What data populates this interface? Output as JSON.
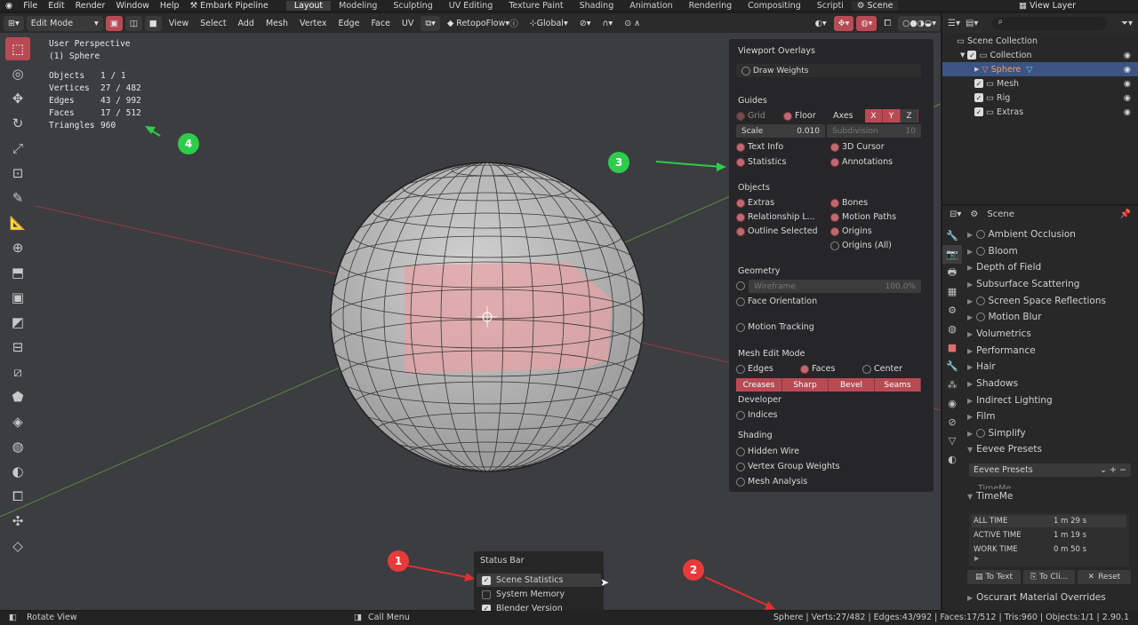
{
  "menu": [
    "File",
    "Edit",
    "Render",
    "Window",
    "Help"
  ],
  "pipeline_label": "Embark Pipeline",
  "workspaces": [
    "Layout",
    "Modeling",
    "Sculpting",
    "UV Editing",
    "Texture Paint",
    "Shading",
    "Animation",
    "Rendering",
    "Compositing",
    "Scripti"
  ],
  "scene_name": "Scene",
  "view_layer": "View Layer",
  "header": {
    "mode": "Edit Mode",
    "menus": [
      "View",
      "Select",
      "Add",
      "Mesh",
      "Vertex",
      "Edge",
      "Face",
      "UV"
    ],
    "retopoflow": "RetopoFlow",
    "transform_orientation": "Global"
  },
  "viewport": {
    "perspective": "User Perspective",
    "object_label": "(1) Sphere",
    "stats": [
      {
        "k": "Objects",
        "v": "1 / 1"
      },
      {
        "k": "Vertices",
        "v": "27 / 482"
      },
      {
        "k": "Edges",
        "v": "43 / 992"
      },
      {
        "k": "Faces",
        "v": "17 / 512"
      },
      {
        "k": "Triangles",
        "v": "960"
      }
    ]
  },
  "overlays": {
    "title": "Viewport Overlays",
    "draw_weights": "Draw Weights",
    "guides": "Guides",
    "grid": "Grid",
    "floor": "Floor",
    "axes": "Axes",
    "axis_x": "X",
    "axis_y": "Y",
    "axis_z": "Z",
    "scale_label": "Scale",
    "scale_value": "0.010",
    "subdivision_label": "Subdivision",
    "subdivision_value": "10",
    "text_info": "Text Info",
    "cursor_3d": "3D Cursor",
    "statistics": "Statistics",
    "annotations": "Annotations",
    "objects": "Objects",
    "extras": "Extras",
    "bones": "Bones",
    "relationship": "Relationship L...",
    "motion_paths": "Motion Paths",
    "outline_selected": "Outline Selected",
    "origins": "Origins",
    "origins_all": "Origins (All)",
    "geometry": "Geometry",
    "wireframe": "Wireframe",
    "wireframe_value": "100.0%",
    "face_orientation": "Face Orientation",
    "motion_tracking": "Motion Tracking",
    "mesh_edit_mode": "Mesh Edit Mode",
    "edges": "Edges",
    "faces": "Faces",
    "center": "Center",
    "creases": "Creases",
    "sharp": "Sharp",
    "bevel": "Bevel",
    "seams": "Seams",
    "developer": "Developer",
    "indices": "Indices",
    "shading": "Shading",
    "hidden_wire": "Hidden Wire",
    "vertex_group_weights": "Vertex Group Weights",
    "mesh_analysis": "Mesh Analysis"
  },
  "status_bar_menu": {
    "title": "Status Bar",
    "items": [
      {
        "label": "Scene Statistics",
        "checked": true
      },
      {
        "label": "System Memory",
        "checked": false
      },
      {
        "label": "Blender Version",
        "checked": true
      }
    ]
  },
  "status": {
    "left": "Rotate View",
    "middle": "Call Menu",
    "right": "Sphere | Verts:27/482 | Edges:43/992 | Faces:17/512 | Tris:960 | Objects:1/1 | 2.90.1"
  },
  "outliner": {
    "rows": [
      {
        "label": "Scene Collection"
      },
      {
        "label": "Collection"
      },
      {
        "label": "Sphere"
      },
      {
        "label": "Mesh"
      },
      {
        "label": "Rig"
      },
      {
        "label": "Extras"
      }
    ]
  },
  "properties": {
    "title": "Scene",
    "sections": [
      "Ambient Occlusion",
      "Bloom",
      "Depth of Field",
      "Subsurface Scattering",
      "Screen Space Reflections",
      "Motion Blur",
      "Volumetrics",
      "Performance",
      "Hair",
      "Shadows",
      "Indirect Lighting",
      "Film",
      "Simplify",
      "Eevee Presets"
    ],
    "presets_field": "Eevee Presets",
    "timeme_ghost": "TimeMe",
    "timeme": "TimeMe",
    "all_time_label": "ALL TIME",
    "all_time": "1 m 29 s",
    "active_time_label": "ACTIVE TIME",
    "active_time": "1 m 19 s",
    "work_time_label": "WORK TIME",
    "work_time": "0 m 50 s",
    "to_text": "To Text",
    "to_clip": "To Cli...",
    "reset": "Reset",
    "oscurart": "Oscurart Material Overrides"
  },
  "badges": [
    "1",
    "2",
    "3",
    "4"
  ],
  "colors": {
    "accent": "#b84a54",
    "badge_red": "#e83a3a",
    "badge_green": "#2ecc4a"
  }
}
